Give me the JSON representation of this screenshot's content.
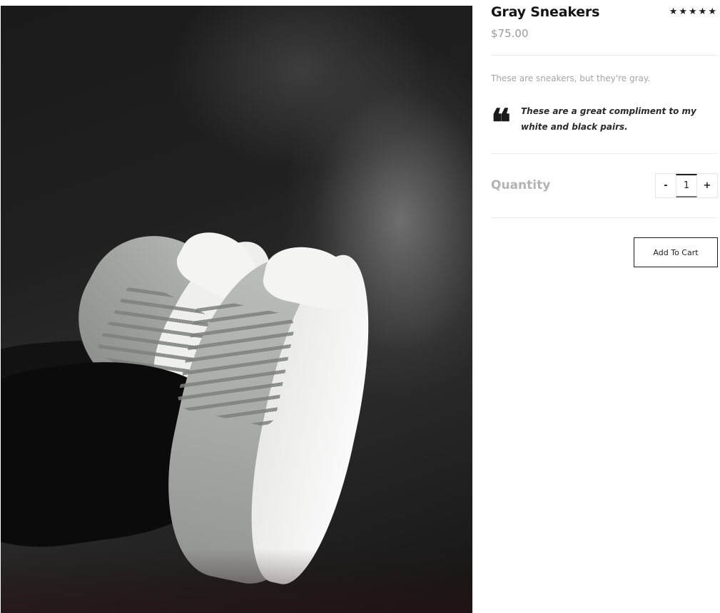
{
  "product": {
    "title": "Gray Sneakers",
    "rating_stars": "★★★★★",
    "rating_value": 5,
    "rating_max": 5,
    "price": "$75.00",
    "description": "These are sneakers, but they're gray.",
    "image_icon": "product-photo"
  },
  "review": {
    "quote_icon": "quote-icon",
    "quote_glyph": "❝",
    "text": "These are a great compliment to my white and black pairs."
  },
  "quantity": {
    "label": "Quantity",
    "decrement_label": "-",
    "value": "1",
    "increment_label": "+"
  },
  "cart": {
    "add_label": "Add To Cart"
  },
  "colors": {
    "title": "#141414",
    "price": "#9a9a9a",
    "description": "#a5a5a5",
    "quantity_label": "#b3b3b3",
    "button_border": "#1c1c1c",
    "divider": "#ececec"
  }
}
